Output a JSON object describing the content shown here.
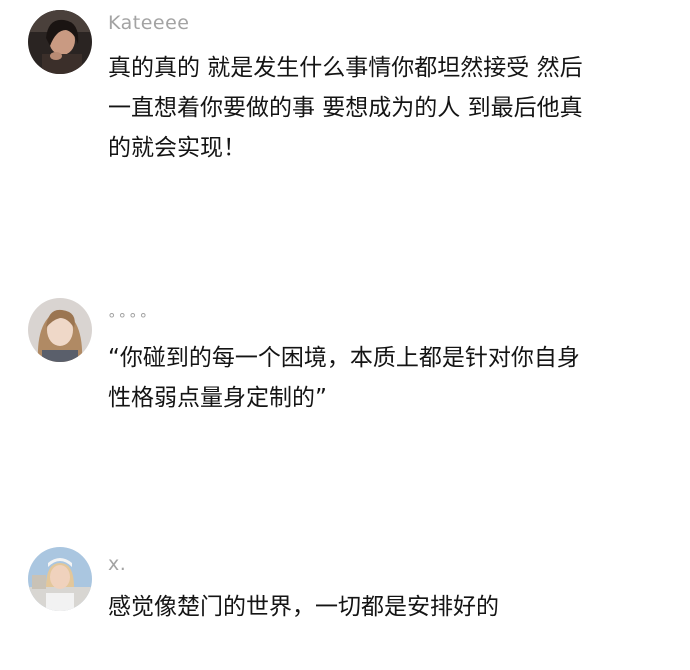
{
  "comments": [
    {
      "username": "Kateeee",
      "lines": [
        "真的真的 就是发生什么事情你都坦然接受 然后",
        "一直想着你要做的事 要想成为的人 到最后他真",
        "的就会实现！"
      ]
    },
    {
      "username": "°°°°",
      "lines": [
        "“你碰到的每一个困境，本质上都是针对你自身",
        "性格弱点量身定制的”"
      ]
    },
    {
      "username": "x.",
      "lines": [
        "感觉像楚门的世界，一切都是安排好的"
      ]
    }
  ]
}
